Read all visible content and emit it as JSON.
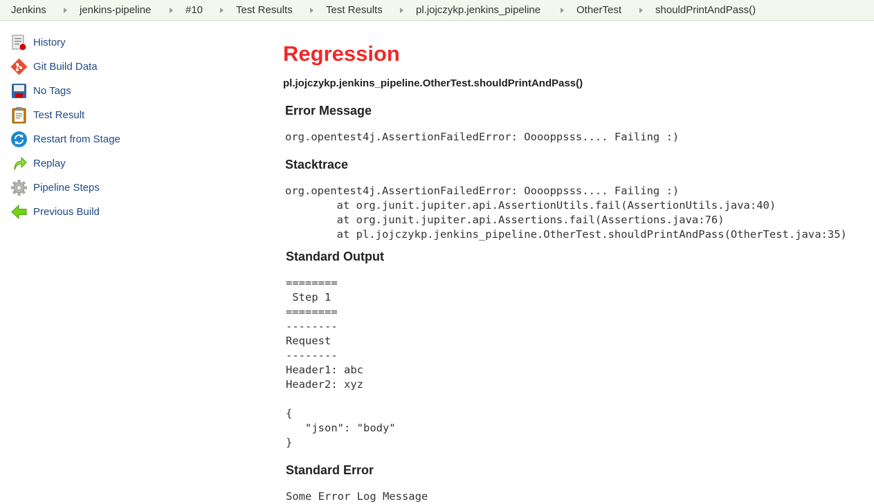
{
  "breadcrumbs": [
    {
      "label": "Jenkins"
    },
    {
      "label": "jenkins-pipeline"
    },
    {
      "label": "#10"
    },
    {
      "label": "Test Results"
    },
    {
      "label": "Test Results"
    },
    {
      "label": "pl.jojczykp.jenkins_pipeline"
    },
    {
      "label": "OtherTest"
    },
    {
      "label": "shouldPrintAndPass()"
    }
  ],
  "sidebar": {
    "items": [
      {
        "label": "History",
        "icon": "history-icon"
      },
      {
        "label": "Git Build Data",
        "icon": "git-icon"
      },
      {
        "label": "No Tags",
        "icon": "save-icon"
      },
      {
        "label": "Test Result",
        "icon": "clipboard-icon"
      },
      {
        "label": "Restart from Stage",
        "icon": "restart-icon"
      },
      {
        "label": "Replay",
        "icon": "replay-icon"
      },
      {
        "label": "Pipeline Steps",
        "icon": "gear-icon"
      },
      {
        "label": "Previous Build",
        "icon": "previous-arrow-icon"
      }
    ]
  },
  "main": {
    "title": "Regression",
    "test_name": "pl.jojczykp.jenkins_pipeline.OtherTest.shouldPrintAndPass()",
    "error_message": {
      "heading": "Error Message",
      "text": "org.opentest4j.AssertionFailedError: Ooooppsss.... Failing :)"
    },
    "stacktrace": {
      "heading": "Stacktrace",
      "text": "org.opentest4j.AssertionFailedError: Ooooppsss.... Failing :)\n\tat org.junit.jupiter.api.AssertionUtils.fail(AssertionUtils.java:40)\n\tat org.junit.jupiter.api.Assertions.fail(Assertions.java:76)\n\tat pl.jojczykp.jenkins_pipeline.OtherTest.shouldPrintAndPass(OtherTest.java:35)"
    },
    "standard_output": {
      "heading": "Standard Output",
      "text": "========\n Step 1\n========\n--------\nRequest\n--------\nHeader1: abc\nHeader2: xyz\n\n{\n   \"json\": \"body\"\n}"
    },
    "standard_error": {
      "heading": "Standard Error",
      "text": "Some Error Log Message"
    }
  },
  "colors": {
    "title_red": "#ef2929",
    "link_blue": "#204a87",
    "breadcrumb_bg": "#f3f8ee"
  }
}
